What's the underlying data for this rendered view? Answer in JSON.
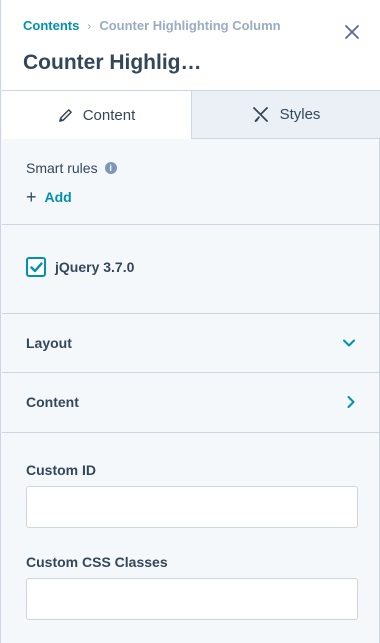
{
  "header": {
    "breadcrumb_root": "Contents",
    "breadcrumb_separator": "›",
    "breadcrumb_current": "Counter Highlighting Column",
    "title": "Counter Highlig…",
    "close_icon": "close-icon"
  },
  "tabs": [
    {
      "label": "Content",
      "icon": "pencil-icon",
      "active": true
    },
    {
      "label": "Styles",
      "icon": "styles-icon",
      "active": false
    }
  ],
  "smart_rules": {
    "label": "Smart rules",
    "info_glyph": "i",
    "add_label": "Add",
    "add_glyph": "+"
  },
  "dependency": {
    "label": "jQuery 3.7.0",
    "checked": true
  },
  "accordions": [
    {
      "label": "Layout",
      "state": "expanded",
      "icon": "chevron-down-icon"
    },
    {
      "label": "Content",
      "state": "collapsed",
      "icon": "chevron-right-icon"
    }
  ],
  "fields": {
    "custom_id": {
      "label": "Custom ID",
      "value": "",
      "placeholder": ""
    },
    "custom_css": {
      "label": "Custom CSS Classes",
      "value": "",
      "placeholder": ""
    }
  },
  "colors": {
    "accent": "#0091ae",
    "text": "#33475b",
    "border": "#cbd6e2",
    "muted": "#99acc2",
    "panel_bg": "#f5f8fa"
  }
}
